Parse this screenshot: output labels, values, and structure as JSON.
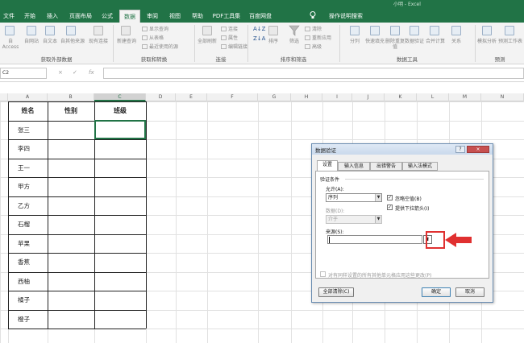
{
  "window": {
    "title": "小明 - Excel"
  },
  "menu": {
    "tabs": [
      "文件",
      "开始",
      "插入",
      "页面布局",
      "公式",
      "数据",
      "审阅",
      "视图",
      "帮助",
      "PDF工具集",
      "百度网盘"
    ],
    "active_tab": "数据",
    "tell_me": "操作说明搜索"
  },
  "ribbon": {
    "get_data": {
      "access": "自 Access",
      "web": "自网站",
      "text": "自文本",
      "other": "自其他来源",
      "existing": "现有连接",
      "label": "获取外部数据"
    },
    "transform": {
      "new_query": "新建查询",
      "show_queries": "显示查询",
      "from_table": "从表格",
      "recent": "最近使用的源",
      "label": "获取和转换"
    },
    "connections": {
      "refresh": "全部刷新",
      "connections": "连接",
      "properties": "属性",
      "edit_links": "编辑链接",
      "label": "连接"
    },
    "sort_filter": {
      "sort": "排序",
      "filter": "筛选",
      "clear": "清除",
      "reapply": "重新应用",
      "advanced": "高级",
      "label": "排序和筛选"
    },
    "data_tools": {
      "split": "分列",
      "flash_fill": "快速填充",
      "remove_dup": "删除重复值",
      "validation": "数据验证",
      "consolidate": "合并计算",
      "relations": "关系",
      "label": "数据工具"
    },
    "forecast": {
      "whatif": "模拟分析",
      "sheet": "预测工作表",
      "label": "预测"
    }
  },
  "formula_bar": {
    "name_box": "C2",
    "cancel": "×",
    "enter": "✓",
    "fx": "fx",
    "value": ""
  },
  "columns": [
    "A",
    "B",
    "C",
    "D",
    "E",
    "F",
    "G",
    "H",
    "I",
    "J",
    "K",
    "L",
    "M",
    "N"
  ],
  "active_column": "C",
  "table": {
    "headers": [
      "姓名",
      "性别",
      "班级"
    ],
    "names": [
      "张三",
      "李四",
      "王一",
      "甲方",
      "乙方",
      "石榴",
      "苹果",
      "香蕉",
      "西柚",
      "橘子",
      "橙子"
    ]
  },
  "dialog": {
    "title": "数据验证",
    "help": "?",
    "close": "×",
    "tabs": [
      "设置",
      "输入信息",
      "出错警告",
      "输入法模式"
    ],
    "active_tab": "设置",
    "section": "验证条件",
    "allow_label": "允许(A):",
    "allow_value": "序列",
    "ignore_blank": "忽略空值(B)",
    "ignore_blank_checked": true,
    "dropdown_label": "提供下拉箭头(I)",
    "dropdown_checked": true,
    "data_label": "数据(D):",
    "data_value": "介于",
    "source_label": "来源(S):",
    "source_value": "",
    "apply_all": "对有同样设置的所有其他单元格应用这些更改(P)",
    "clear_all": "全部清除(C)",
    "ok": "确定",
    "cancel": "取消"
  },
  "colors": {
    "excel_green": "#217346",
    "highlight_red": "#e03030"
  }
}
